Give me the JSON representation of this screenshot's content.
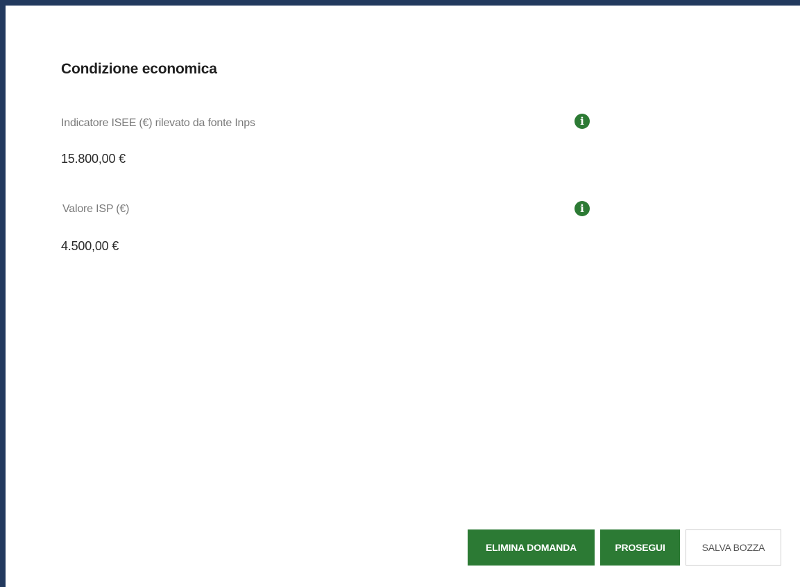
{
  "section": {
    "title": "Condizione economica"
  },
  "fields": [
    {
      "label": "Indicatore ISEE (€) rilevato da fonte Inps",
      "value": "15.800,00 €",
      "info_icon": "info-icon"
    },
    {
      "label": "Valore ISP (€)",
      "value": "4.500,00 €",
      "info_icon": "info-icon"
    }
  ],
  "actions": {
    "delete_label": "ELIMINA DOMANDA",
    "continue_label": "PROSEGUI",
    "save_draft_label": "SALVA BOZZA"
  },
  "colors": {
    "frame_border": "#22395e",
    "primary_green": "#2c7a34",
    "label_gray": "#7a7a7a"
  }
}
